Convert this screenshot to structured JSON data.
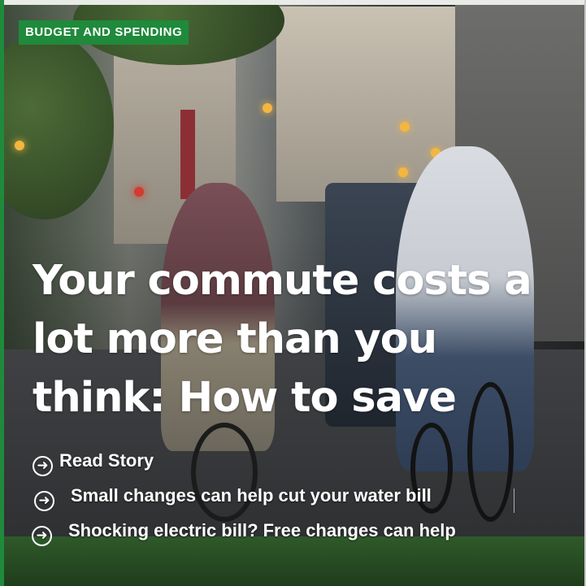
{
  "card": {
    "category": "BUDGET AND SPENDING",
    "headline": "Your commute costs a lot more than you think: How to save",
    "links": [
      {
        "label": "Read Story",
        "icon": "circle-arrow-right-icon"
      },
      {
        "label": "Small changes can help cut your water bill",
        "icon": "circle-arrow-right-icon"
      },
      {
        "label": "Shocking electric bill? Free changes can help",
        "icon": "circle-arrow-right-icon"
      }
    ]
  },
  "colors": {
    "category_badge": "#1f8a3b",
    "text": "#ffffff"
  }
}
